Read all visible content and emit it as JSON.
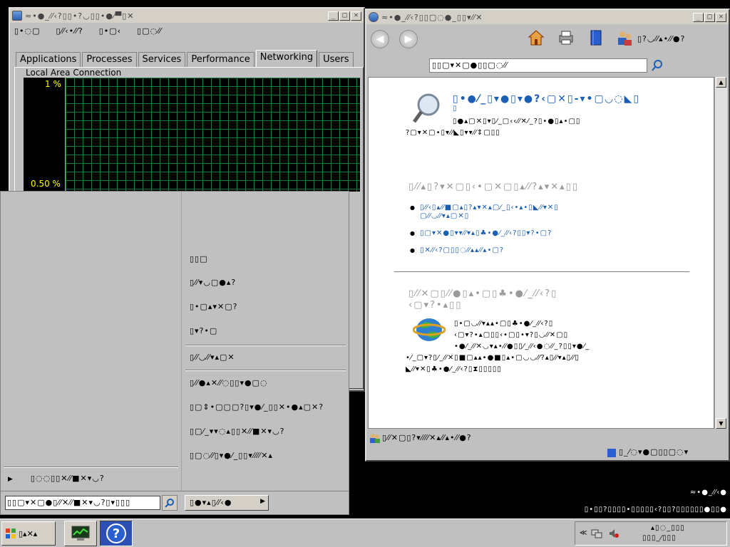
{
  "taskmgr": {
    "title": "≈•●_⁄⁄‹?▯▯•?◡▯▯•●⁄▀▯✕",
    "menus": [
      "▯•◌▢",
      "▯⁄⁄‹•⁄⁄?",
      "▯•▢‹",
      "▯▢◌⁄⁄"
    ],
    "tabs": [
      "Applications",
      "Processes",
      "Services",
      "Performance",
      "Networking",
      "Users"
    ],
    "active_tab": "Networking",
    "group_label": "Local Area Connection",
    "y_labels": [
      "1 %",
      "0.50 %"
    ]
  },
  "startmenu": {
    "right_items": [
      "▯▯□",
      "▯⁄⁄▾◡▢●▴?",
      "▯•▢▴▾✕▢?",
      "▯▾?•▢",
      "▯⁄⁄◡⁄⁄▾▴▢✕",
      "▯⁄⁄●▴✕⁄⁄◌▯▯▾●▢◌",
      "▯▢⇕•▢▢▢?▯▾●⁄_▯▯✕•●▴▢✕?",
      "▯▢⁄_▾▾◌▴▯▯✕⁄⁄■✕▾◡?",
      "▯▢◌⁄⁄▯▾●⁄_▯▯▾⁄⁄⁄⁄✕▴"
    ],
    "all_programs": "▯◌◌▯▯✕⁄⁄■✕▾◡?",
    "search_placeholder": "▯▯▢▾✕▢●▯⁄⁄✕⁄⁄■✕▾◡?▯▾▯▯▯",
    "shutdown_label": "▯●▾▴▯⁄⁄‹●"
  },
  "helpwin": {
    "title": "≈•●_⁄⁄‹?▯▯▢◌●_▯▯▾⁄⁄✕",
    "toolbar_text": "▯?◡⁄⁄▴•⁄⁄●?",
    "search_value": "▯▯▢▾✕▢●▯▯▢◌⁄⁄",
    "heading1": "▯•●⁄_▯▾●▯▾●?‹▢✕▯-▾•▢◡◌◣▯",
    "heading1_line2": "▯",
    "text1": "▯●▴▢✕▯▾▯⁄_▢‹‹⁄⁄✕⁄_?▯•●▯▴•▢▯",
    "text1_line2": "?▢▾✕▢•▯▾⁄⁄◣▯▾▾⁄⁄⇕▢▯▯",
    "sub1": "▯⁄⁄▴▯?▾✕▢▯‹•▢✕▢▯▴⁄⁄?▴▾✕▴▯▯",
    "links": [
      "▯⁄⁄‹▯▴⁄⁄■▢▴▯?▴▾✕▴▢⁄_▯‹•▴•▯◣⁄⁄▾✕▯",
      "▢⁄⁄◡⁄⁄▾▴▢✕▯",
      "▯▢▾✕●▯▾▾⁄⁄▾▴▯♣•●⁄_⁄⁄‹?▯▯▾?•▢?",
      "▯✕⁄⁄‹?▢▯▯◌⁄⁄▴▴⁄⁄▴•▢?"
    ],
    "sub2": "▯⁄⁄✕▢▯⁄⁄●▯▴•▢▯♣•●⁄_⁄⁄‹?▯",
    "sub2_line2": "‹▢▾?•▴▯▯",
    "text2": "▯•▢◡⁄⁄▾▴▴•▢▯♣•●⁄_⁄⁄‹?▯",
    "text2_line2": "‹▢▾?•▴▢▯▯‹•▢▯•▾?▯◡⁄⁄✕▢▯",
    "text2_line3": "•●⁄_⁄⁄✕◡▾▴•⁄⁄●▯▯⁄_⁄⁄‹●◌⁄⁄_?▯▯▾●⁄_",
    "text2_line4": "•⁄_▢▾?▯⁄_⁄⁄✕▯■▢▴▴•●■▯▴•▢◡◡⁄⁄?▴▯⁄⁄▾▴▯⁄⁄▯",
    "text2_line5": "◣⁄⁄▾✕▯♣•●⁄_⁄⁄‹?▯⧗▯▯▯▯▯",
    "status1": "▯⁄⁄✕▢▯?▾⁄⁄⁄⁄✕▴⁄⁄▴•⁄⁄●?",
    "status2": "▯_⁄◌▾●▢▯▯▢◌▾"
  },
  "tray_notes": [
    "≈•●_⁄⁄‹●",
    "▯•▯▯?▯▯▯▯•▯▯▯▯▯‹?▯▯?▯▯▯▯▯▯●▯▯●"
  ],
  "taskbar": {
    "start_label": "▯▴✕▴",
    "tray_text1": "▴▯◌_▯▯▯",
    "tray_text2": "▯▯▯_⁄▯▯▯"
  }
}
